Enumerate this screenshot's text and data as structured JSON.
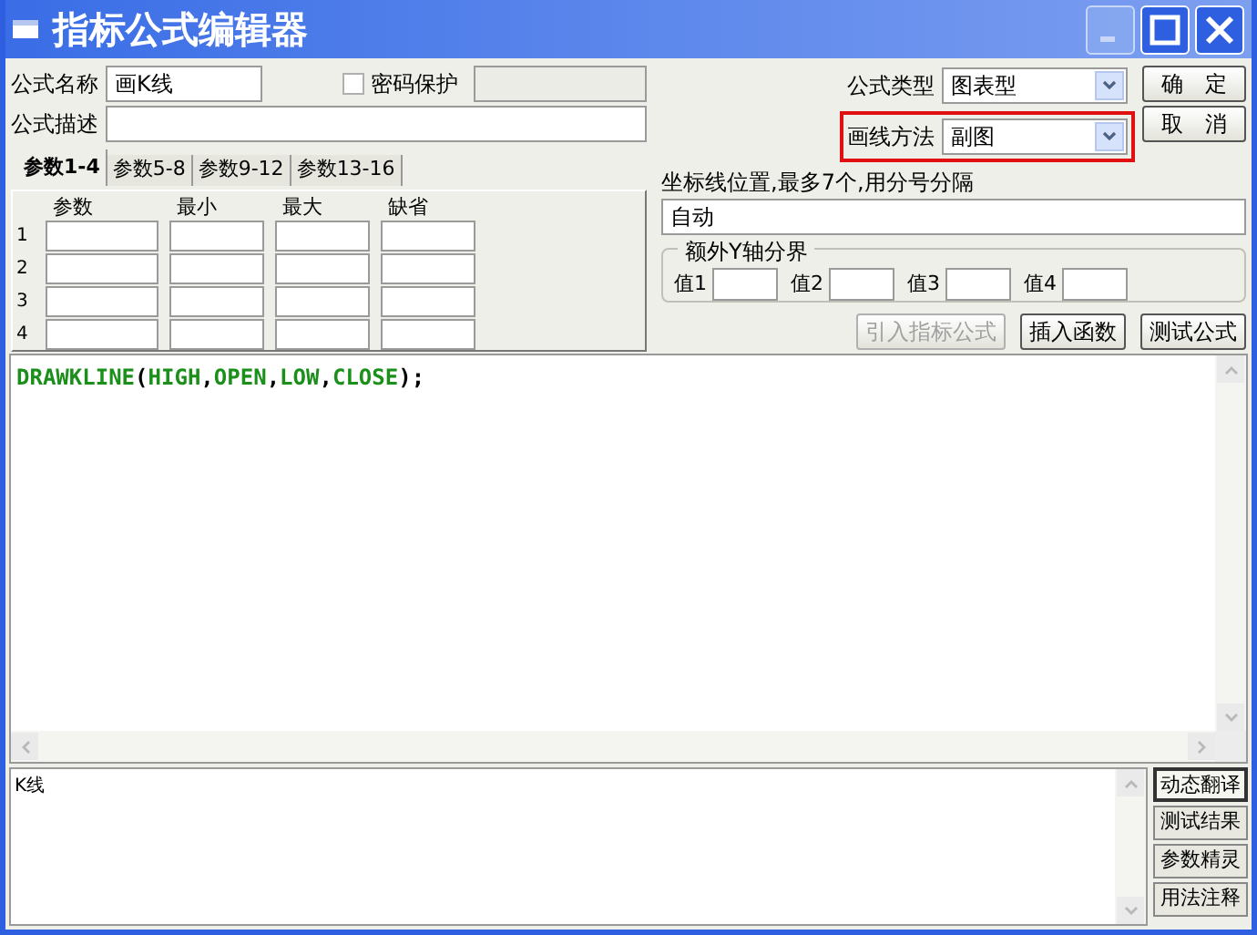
{
  "window": {
    "title": "指标公式编辑器",
    "controls": [
      {
        "kind": "minimize",
        "disabled": true
      },
      {
        "kind": "maximize",
        "disabled": false
      },
      {
        "kind": "close",
        "disabled": false
      }
    ]
  },
  "name_field": {
    "label": "公式名称",
    "value": "画K线"
  },
  "password": {
    "label": "密码保护",
    "checked": false
  },
  "description_field": {
    "label": "公式描述"
  },
  "formula_type": {
    "label": "公式类型",
    "value": "图表型"
  },
  "draw_method": {
    "label": "画线方法",
    "value": "副图",
    "highlighted": true
  },
  "dialog_buttons": [
    "确　定",
    "取　消"
  ],
  "tabs": [
    {
      "label": "参数1-4",
      "selected": true
    },
    {
      "label": "参数5-8",
      "selected": false
    },
    {
      "label": "参数9-12",
      "selected": false
    },
    {
      "label": "参数13-16",
      "selected": false
    }
  ],
  "param_table": {
    "columns": [
      "参数",
      "最小",
      "最大",
      "缺省"
    ],
    "rows": [
      "1",
      "2",
      "3",
      "4"
    ]
  },
  "axis_lines": {
    "label": "坐标线位置,最多7个,用分号分隔",
    "value": "自动"
  },
  "y_axis_group": {
    "title": "额外Y轴分界",
    "fields": [
      "值1",
      "值2",
      "值3",
      "值4"
    ]
  },
  "tool_buttons": [
    {
      "label": "引入指标公式",
      "disabled": true
    },
    {
      "label": "插入函数",
      "disabled": false
    },
    {
      "label": "测试公式",
      "disabled": false
    }
  ],
  "code": [
    {
      "text": "DRAWKLINE",
      "kind": "function"
    },
    {
      "text": "(",
      "kind": "punct"
    },
    {
      "text": "HIGH",
      "kind": "function"
    },
    {
      "text": ",",
      "kind": "punct"
    },
    {
      "text": "OPEN",
      "kind": "function"
    },
    {
      "text": ",",
      "kind": "punct"
    },
    {
      "text": "LOW",
      "kind": "function"
    },
    {
      "text": ",",
      "kind": "punct"
    },
    {
      "text": "CLOSE",
      "kind": "function"
    },
    {
      "text": ");",
      "kind": "punct"
    }
  ],
  "output": {
    "text": "K线"
  },
  "side_buttons": [
    {
      "label": "动态翻译",
      "selected": true
    },
    {
      "label": "测试结果",
      "selected": false
    },
    {
      "label": "参数精灵",
      "selected": false
    },
    {
      "label": "用法注释",
      "selected": false
    }
  ]
}
